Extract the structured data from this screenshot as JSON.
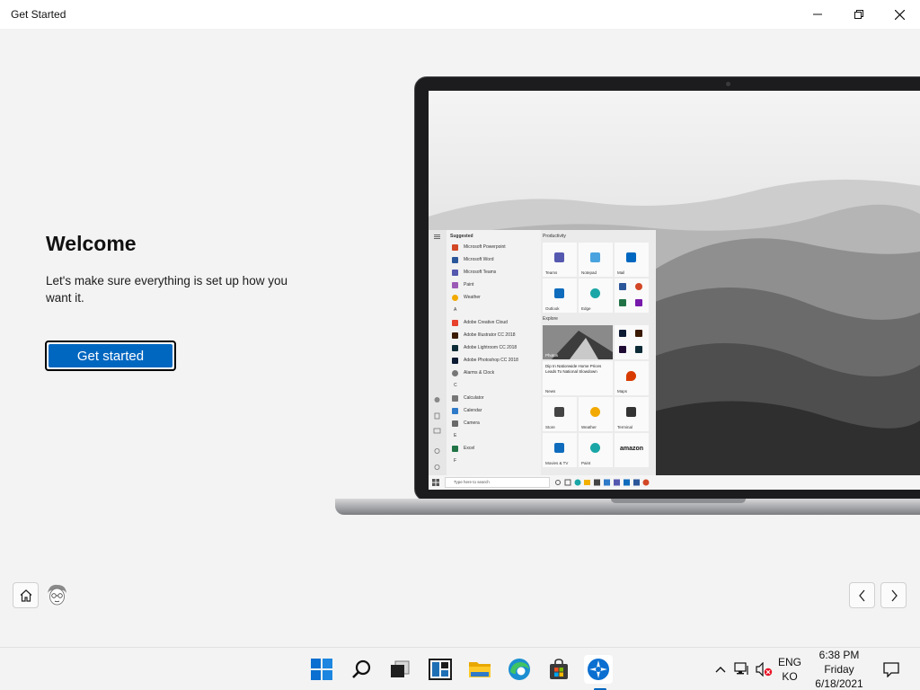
{
  "window": {
    "title": "Get Started",
    "controls": [
      "minimize",
      "restore",
      "close"
    ]
  },
  "main": {
    "heading": "Welcome",
    "subtitle": "Let's make sure everything is set up how you want it.",
    "primary_button": "Get started"
  },
  "illustration": {
    "start_menu": {
      "suggested_label": "Suggested",
      "productivity_label": "Productivity",
      "explore_label": "Explore",
      "apps": [
        {
          "label": "Microsoft Powerpoint",
          "color": "#d24726"
        },
        {
          "label": "Microsoft Word",
          "color": "#2b579a"
        },
        {
          "label": "Microsoft Teams",
          "color": "#5558af"
        },
        {
          "label": "Paint",
          "color": "#9b59b6"
        },
        {
          "label": "Weather",
          "color": "#f2a900"
        },
        {
          "label": "A",
          "color": ""
        },
        {
          "label": "Adobe Creative Cloud",
          "color": "#e8412c"
        },
        {
          "label": "Adobe Illustrator CC 2018",
          "color": "#3b1a04"
        },
        {
          "label": "Adobe Lightroom CC 2018",
          "color": "#0c2b36"
        },
        {
          "label": "Adobe Photoshop CC 2018",
          "color": "#0d1b33"
        },
        {
          "label": "Alarms & Clock",
          "color": "#777777"
        },
        {
          "label": "C",
          "color": ""
        },
        {
          "label": "Calculator",
          "color": "#777777"
        },
        {
          "label": "Calendar",
          "color": "#2f79c9"
        },
        {
          "label": "Camera",
          "color": "#6a6a6a"
        },
        {
          "label": "E",
          "color": ""
        },
        {
          "label": "Excel",
          "color": "#217346"
        },
        {
          "label": "F",
          "color": ""
        }
      ],
      "tiles": [
        {
          "label": "Teams",
          "color": "#5558af"
        },
        {
          "label": "Notepad",
          "color": "#4aa3df"
        },
        {
          "label": "Mail",
          "color": "#0067c0"
        },
        {
          "label": "Outlook",
          "color": "#0f6cbd"
        },
        {
          "label": "Edge",
          "color": "#1aa6a6"
        },
        {
          "label": "Photos",
          "color": "#666666"
        },
        {
          "label": "News",
          "color": "#444444"
        },
        {
          "label": "Maps",
          "color": "#d83b01"
        },
        {
          "label": "Store",
          "color": "#444444"
        },
        {
          "label": "Weather",
          "color": "#f2a900"
        },
        {
          "label": "Terminal",
          "color": "#333333"
        },
        {
          "label": "Movies & TV",
          "color": "#0f6cbd"
        },
        {
          "label": "Paint",
          "color": "#1aa6a6"
        },
        {
          "label": "amazon",
          "color": "#111111"
        }
      ],
      "news_headline": "Dip In Nationwide Home Prices Leads To National Slowdown",
      "search_placeholder": "Type here to search"
    }
  },
  "bottom_nav": {
    "home": "home-icon",
    "prev": "chevron-left-icon",
    "next": "chevron-right-icon"
  },
  "taskbar": {
    "icons": [
      "windows-start-icon",
      "search-icon",
      "task-view-icon",
      "widgets-icon",
      "file-explorer-icon",
      "edge-icon",
      "store-icon",
      "get-started-icon"
    ],
    "tray": {
      "lang_top": "ENG",
      "lang_bottom": "KO",
      "time": "6:38 PM",
      "day": "Friday",
      "date": "6/18/2021"
    }
  }
}
